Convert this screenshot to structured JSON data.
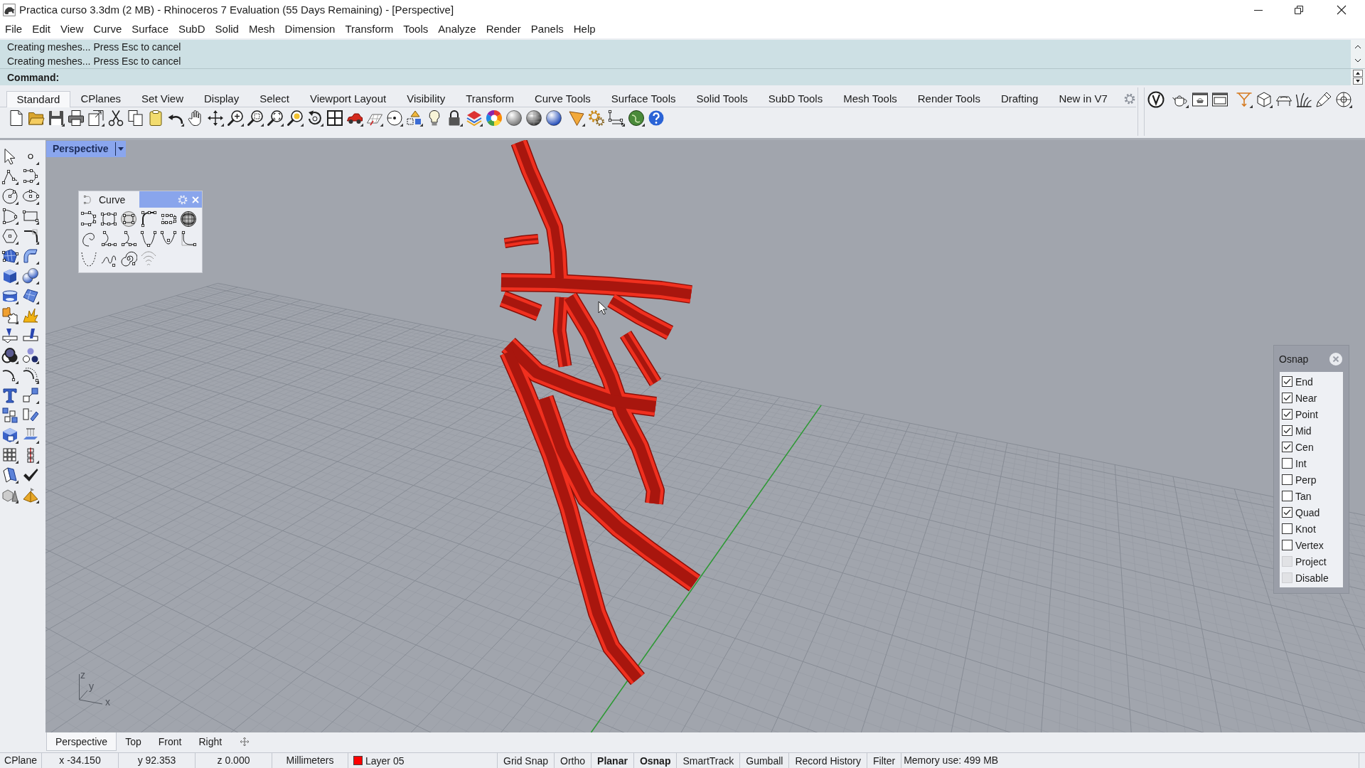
{
  "window": {
    "title": "Practica curso 3.3dm (2 MB) - Rhinoceros 7 Evaluation (55 Days Remaining) - [Perspective]"
  },
  "menu": [
    "File",
    "Edit",
    "View",
    "Curve",
    "Surface",
    "SubD",
    "Solid",
    "Mesh",
    "Dimension",
    "Transform",
    "Tools",
    "Analyze",
    "Render",
    "Panels",
    "Help"
  ],
  "command_area": {
    "history": [
      "Creating meshes... Press Esc to cancel",
      "Creating meshes... Press Esc to cancel"
    ],
    "prompt": "Command:"
  },
  "toolbar_tabs": [
    {
      "label": "Standard",
      "selected": true
    },
    {
      "label": "CPlanes",
      "selected": false
    },
    {
      "label": "Set View",
      "selected": false
    },
    {
      "label": "Display",
      "selected": false
    },
    {
      "label": "Select",
      "selected": false
    },
    {
      "label": "Viewport Layout",
      "selected": false
    },
    {
      "label": "Visibility",
      "selected": false
    },
    {
      "label": "Transform",
      "selected": false
    },
    {
      "label": "Curve Tools",
      "selected": false
    },
    {
      "label": "Surface Tools",
      "selected": false
    },
    {
      "label": "Solid Tools",
      "selected": false
    },
    {
      "label": "SubD Tools",
      "selected": false
    },
    {
      "label": "Mesh Tools",
      "selected": false
    },
    {
      "label": "Render Tools",
      "selected": false
    },
    {
      "label": "Drafting",
      "selected": false
    },
    {
      "label": "New in V7",
      "selected": false
    }
  ],
  "viewport": {
    "title": "Perspective",
    "axis_labels": [
      "z",
      "y",
      "x"
    ]
  },
  "curve_panel": {
    "title": "Curve"
  },
  "osnap_panel": {
    "title": "Osnap",
    "items": [
      {
        "label": "End",
        "checked": true,
        "disabled": false
      },
      {
        "label": "Near",
        "checked": true,
        "disabled": false
      },
      {
        "label": "Point",
        "checked": true,
        "disabled": false
      },
      {
        "label": "Mid",
        "checked": true,
        "disabled": false
      },
      {
        "label": "Cen",
        "checked": true,
        "disabled": false
      },
      {
        "label": "Int",
        "checked": false,
        "disabled": false
      },
      {
        "label": "Perp",
        "checked": false,
        "disabled": false
      },
      {
        "label": "Tan",
        "checked": false,
        "disabled": false
      },
      {
        "label": "Quad",
        "checked": true,
        "disabled": false
      },
      {
        "label": "Knot",
        "checked": false,
        "disabled": false
      },
      {
        "label": "Vertex",
        "checked": false,
        "disabled": false
      },
      {
        "label": "Project",
        "checked": false,
        "disabled": true
      },
      {
        "label": "Disable",
        "checked": false,
        "disabled": true
      }
    ]
  },
  "viewport_tabs": [
    {
      "label": "Perspective",
      "selected": true
    },
    {
      "label": "Top",
      "selected": false
    },
    {
      "label": "Front",
      "selected": false
    },
    {
      "label": "Right",
      "selected": false
    }
  ],
  "status_bar": {
    "cplane": "CPlane",
    "coordinates": [
      "x -34.150",
      "y 92.353",
      "z 0.000"
    ],
    "units": "Millimeters",
    "layer": {
      "label": "Layer 05",
      "color": "#ff0000"
    },
    "toggles": [
      {
        "label": "Grid Snap",
        "on": false
      },
      {
        "label": "Ortho",
        "on": false
      },
      {
        "label": "Planar",
        "on": true
      },
      {
        "label": "Osnap",
        "on": true
      },
      {
        "label": "SmartTrack",
        "on": false
      },
      {
        "label": "Gumball",
        "on": false
      },
      {
        "label": "Record History",
        "on": false
      },
      {
        "label": "Filter",
        "on": false
      }
    ],
    "memory": "Memory use: 499 MB"
  }
}
